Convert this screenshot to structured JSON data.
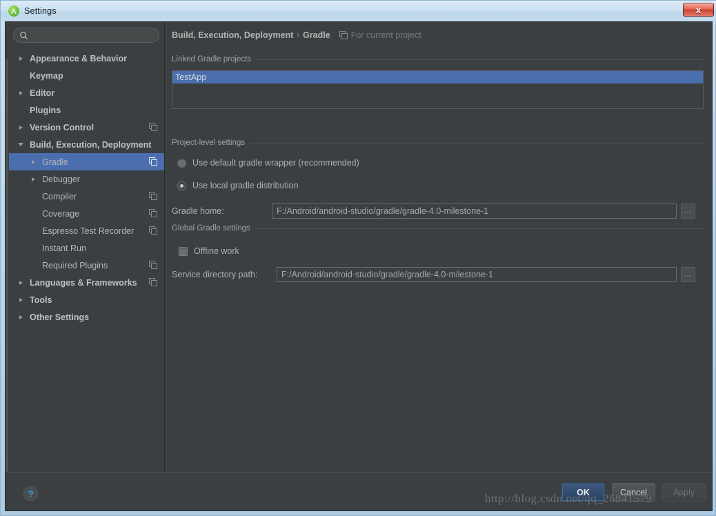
{
  "window": {
    "title": "Settings",
    "app_icon": "android-studio-icon",
    "close_label": "x"
  },
  "sidebar": {
    "search": {
      "value": "",
      "placeholder": "",
      "icon": "search-icon"
    },
    "items": [
      {
        "label": "Appearance & Behavior",
        "arrow": "collapsed",
        "indent": 0,
        "bold": true,
        "scope_icon": false,
        "selected": false
      },
      {
        "label": "Keymap",
        "arrow": "none",
        "indent": 0,
        "bold": true,
        "scope_icon": false,
        "selected": false
      },
      {
        "label": "Editor",
        "arrow": "collapsed",
        "indent": 0,
        "bold": true,
        "scope_icon": false,
        "selected": false
      },
      {
        "label": "Plugins",
        "arrow": "none",
        "indent": 0,
        "bold": true,
        "scope_icon": false,
        "selected": false
      },
      {
        "label": "Version Control",
        "arrow": "collapsed",
        "indent": 0,
        "bold": true,
        "scope_icon": true,
        "selected": false
      },
      {
        "label": "Build, Execution, Deployment",
        "arrow": "expanded",
        "indent": 0,
        "bold": true,
        "scope_icon": false,
        "selected": false
      },
      {
        "label": "Gradle",
        "arrow": "collapsed",
        "indent": 1,
        "bold": false,
        "scope_icon": true,
        "selected": true
      },
      {
        "label": "Debugger",
        "arrow": "collapsed",
        "indent": 1,
        "bold": false,
        "scope_icon": false,
        "selected": false
      },
      {
        "label": "Compiler",
        "arrow": "none",
        "indent": 1,
        "bold": false,
        "scope_icon": true,
        "selected": false
      },
      {
        "label": "Coverage",
        "arrow": "none",
        "indent": 1,
        "bold": false,
        "scope_icon": true,
        "selected": false
      },
      {
        "label": "Espresso Test Recorder",
        "arrow": "none",
        "indent": 1,
        "bold": false,
        "scope_icon": true,
        "selected": false
      },
      {
        "label": "Instant Run",
        "arrow": "none",
        "indent": 1,
        "bold": false,
        "scope_icon": false,
        "selected": false
      },
      {
        "label": "Required Plugins",
        "arrow": "none",
        "indent": 1,
        "bold": false,
        "scope_icon": true,
        "selected": false
      },
      {
        "label": "Languages & Frameworks",
        "arrow": "collapsed",
        "indent": 0,
        "bold": true,
        "scope_icon": true,
        "selected": false
      },
      {
        "label": "Tools",
        "arrow": "collapsed",
        "indent": 0,
        "bold": true,
        "scope_icon": false,
        "selected": false
      },
      {
        "label": "Other Settings",
        "arrow": "collapsed",
        "indent": 0,
        "bold": true,
        "scope_icon": false,
        "selected": false
      }
    ]
  },
  "content": {
    "breadcrumb": {
      "parent": "Build, Execution, Deployment",
      "separator": "›",
      "current": "Gradle",
      "scope_icon": "project-scope-icon",
      "scope_label": "For current project"
    },
    "linked_projects": {
      "group_title": "Linked Gradle projects",
      "items": [
        "TestApp"
      ]
    },
    "project_level": {
      "group_title": "Project-level settings",
      "radio_wrapper": "Use default gradle wrapper (recommended)",
      "radio_local": "Use local gradle distribution",
      "radio_selected": "local",
      "gradle_home_label": "Gradle home:",
      "gradle_home_value": "F:/Android/android-studio/gradle/gradle-4.0-milestone-1",
      "browse_label": "..."
    },
    "global_settings": {
      "group_title": "Global Gradle settings",
      "offline_label": "Offline work",
      "offline_checked": false,
      "service_dir_label": "Service directory path:",
      "service_dir_value": "F:/Android/android-studio/gradle/gradle-4.0-milestone-1",
      "browse_label": "..."
    }
  },
  "footer": {
    "help_label": "?",
    "ok_label": "OK",
    "cancel_label": "Cancel",
    "apply_label": "Apply"
  },
  "watermark": "http://blog.csdn.net/qq_26841579",
  "colors": {
    "dialog_bg": "#3c3f41",
    "selection_blue": "#4b6eaf",
    "text": "#b0b0b0",
    "accent_help": "#27a5e0",
    "titlebar_top": "#dcebf7"
  }
}
